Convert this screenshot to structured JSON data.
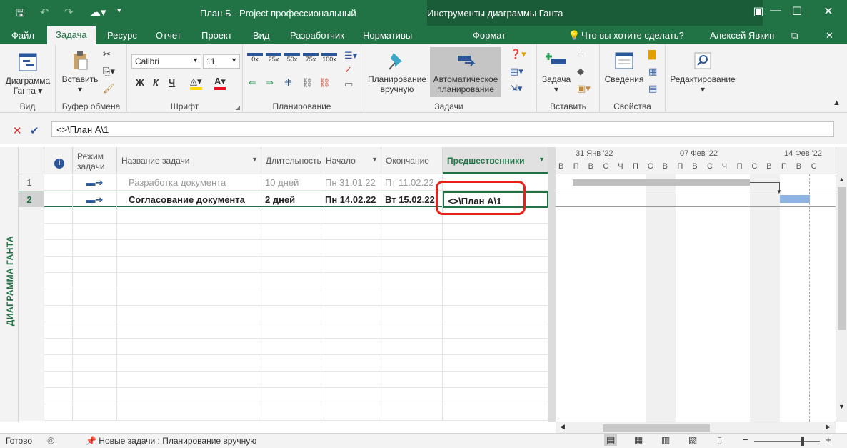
{
  "window": {
    "title": "План Б - Project профессиональный",
    "tools_title": "Инструменты диаграммы Ганта",
    "user": "Алексей Явкин",
    "help_prompt": "Что вы хотите сделать?"
  },
  "tabs": [
    "Файл",
    "Задача",
    "Ресурс",
    "Отчет",
    "Проект",
    "Вид",
    "Разработчик",
    "Нормативы",
    "Формат"
  ],
  "ribbon": {
    "view": {
      "button": "Диаграмма Ганта",
      "label": "Вид"
    },
    "clipboard": {
      "paste": "Вставить",
      "label": "Буфер обмена"
    },
    "font": {
      "name": "Calibri",
      "size": "11",
      "bold": "Ж",
      "italic": "К",
      "underline": "Ч",
      "label": "Шрифт"
    },
    "schedule": {
      "pcts": [
        "0x",
        "25x",
        "50x",
        "75x",
        "100x"
      ],
      "label": "Планирование"
    },
    "tasks": {
      "manual": "Планирование вручную",
      "auto": "Автоматическое планирование",
      "label": "Задачи"
    },
    "insert": {
      "task": "Задача",
      "label": "Вставить"
    },
    "properties": {
      "info": "Сведения",
      "label": "Свойства"
    },
    "editing": {
      "label": "Редактирование"
    }
  },
  "formula": {
    "value": "<>\\План А\\1"
  },
  "sidebar_label": "ДИАГРАММА ГАНТА",
  "columns": [
    "Режим задачи",
    "Название задачи",
    "Длительность",
    "Начало",
    "Окончание",
    "Предшественники"
  ],
  "rows": [
    {
      "id": "1",
      "name": "Разработка документа",
      "duration": "10 дней",
      "start": "Пн 31.01.22",
      "finish": "Пт 11.02.22",
      "pred": ""
    },
    {
      "id": "2",
      "name": "Согласование документа",
      "duration": "2 дней",
      "start": "Пн 14.02.22",
      "finish": "Вт 15.02.22",
      "pred": "<>\\План А\\1"
    }
  ],
  "timescale": {
    "weeks": [
      "31 Янв '22",
      "07 Фев '22",
      "14 Фев '22"
    ],
    "days": [
      "В",
      "П",
      "В",
      "С",
      "Ч",
      "П",
      "С",
      "В",
      "П",
      "В",
      "С",
      "Ч",
      "П",
      "С",
      "В",
      "П",
      "В",
      "С"
    ]
  },
  "status": {
    "ready": "Готово",
    "newtasks": "Новые задачи : Планирование вручную"
  },
  "colors": {
    "accent": "#217346",
    "highlight": "#e8211b",
    "bar_summary": "#bfbfbf",
    "bar_task": "#8db4e2"
  }
}
